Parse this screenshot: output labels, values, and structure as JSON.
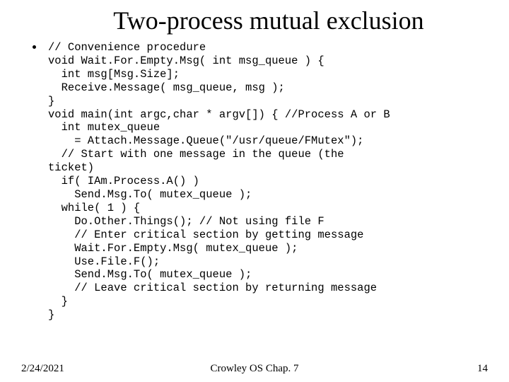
{
  "title": "Two-process mutual exclusion",
  "code": "// Convenience procedure\nvoid Wait.For.Empty.Msg( int msg_queue ) {\n  int msg[Msg.Size];\n  Receive.Message( msg_queue, msg );\n}\nvoid main(int argc,char * argv[]) { //Process A or B\n  int mutex_queue\n    = Attach.Message.Queue(\"/usr/queue/FMutex\");\n  // Start with one message in the queue (the\nticket)\n  if( IAm.Process.A() )\n    Send.Msg.To( mutex_queue );\n  while( 1 ) {\n    Do.Other.Things(); // Not using file F\n    // Enter critical section by getting message\n    Wait.For.Empty.Msg( mutex_queue );\n    Use.File.F();\n    Send.Msg.To( mutex_queue );\n    // Leave critical section by returning message\n  }\n}",
  "footer": {
    "date": "2/24/2021",
    "center": "Crowley   OS   Chap. 7",
    "page": "14"
  }
}
